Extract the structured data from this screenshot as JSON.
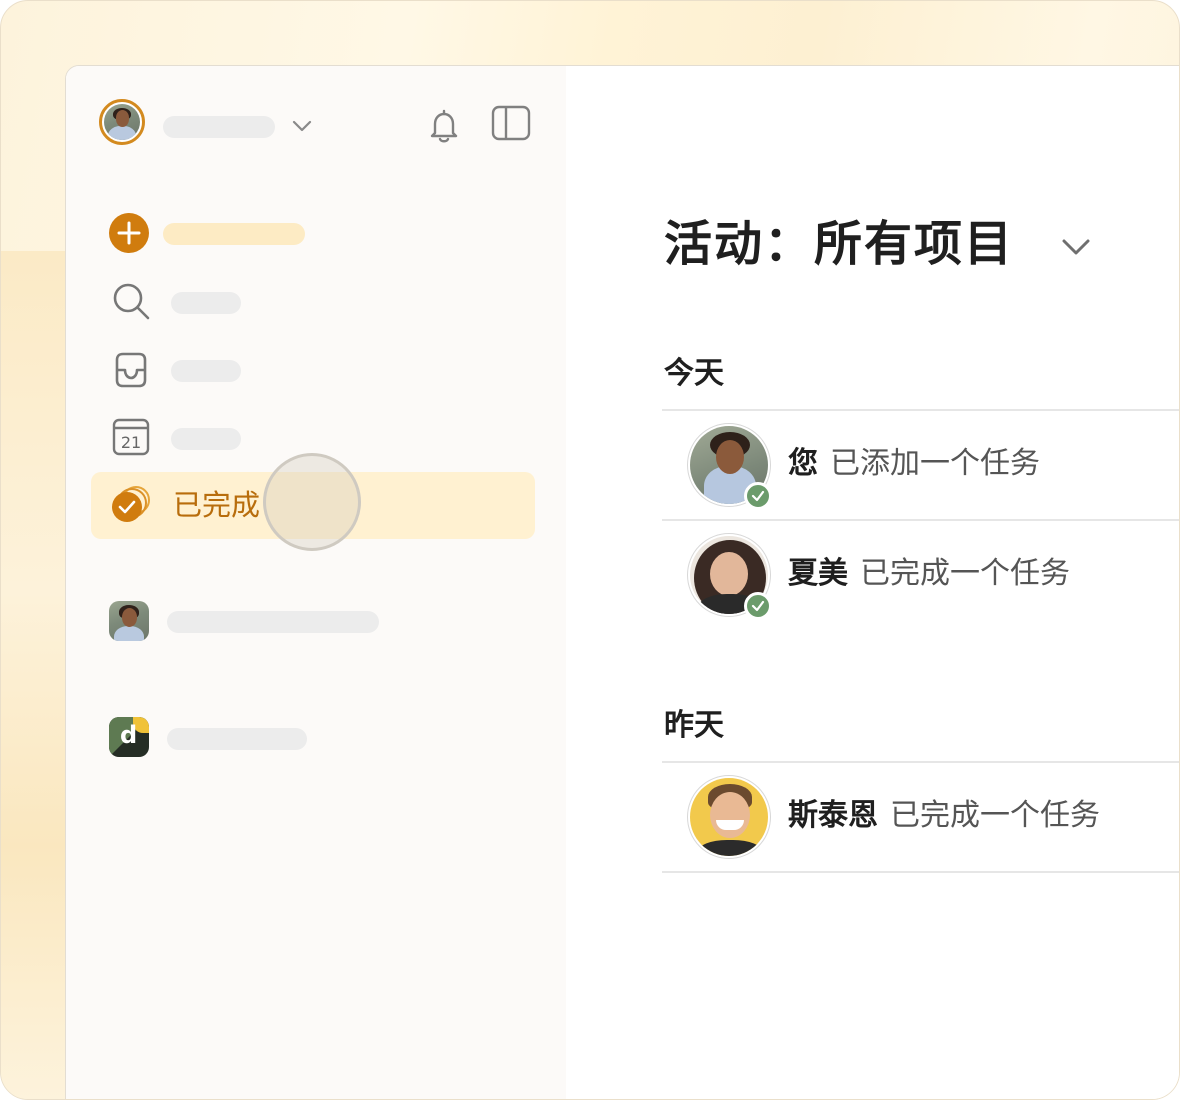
{
  "sidebar": {
    "active_item_label": "已完成"
  },
  "main": {
    "page_title": "活动：所有项目",
    "sections": [
      {
        "label": "今天",
        "activities": [
          {
            "actor": "您",
            "action": "已添加一个任务"
          },
          {
            "actor": "夏美",
            "action": "已完成一个任务"
          }
        ]
      },
      {
        "label": "昨天",
        "activities": [
          {
            "actor": "斯泰恩",
            "action": "已完成一个任务"
          }
        ]
      }
    ]
  },
  "colors": {
    "accent": "#d07c0e",
    "active_bg": "#fff1d1",
    "check_green": "#6b9b6b"
  }
}
